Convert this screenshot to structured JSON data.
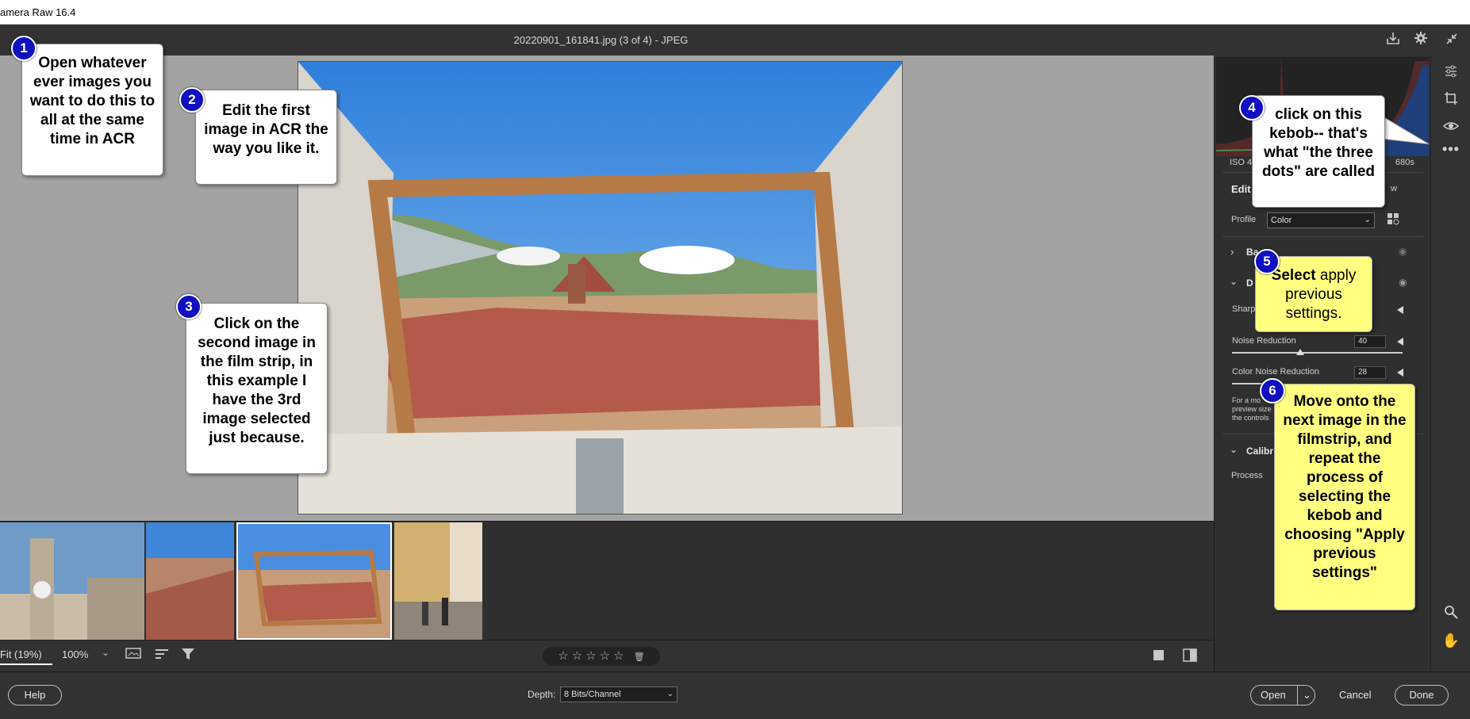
{
  "app": {
    "title": "amera Raw 16.4"
  },
  "header": {
    "filename": "20220901_161841.jpg (3 of 4)  -  JPEG"
  },
  "panel": {
    "histogram_left": "ISO 4",
    "histogram_right": "680s",
    "edit_label": "Edit",
    "edit_right": "w",
    "profile_label": "Profile",
    "profile_value": "Color",
    "basic_label": "Ba",
    "detail_label": "D",
    "sharpening_label": "Sharp",
    "noise_label": "Noise Reduction",
    "noise_value": "40",
    "noise_level": 0.4,
    "color_noise_label": "Color Noise Reduction",
    "color_noise_value": "28",
    "note_lines": [
      "For a mo",
      "preview size",
      "the controls"
    ],
    "calibration_label": "Calibr",
    "process_label": "Process"
  },
  "bottombar": {
    "zoom_fit": "Fit (19%)",
    "zoom_pct": "100%",
    "stars": "☆☆☆☆☆",
    "trash": "🗑"
  },
  "footer": {
    "help": "Help",
    "depth_label": "Depth:",
    "depth_value": "8 Bits/Channel",
    "open": "Open",
    "cancel": "Cancel",
    "done": "Done"
  },
  "callouts": [
    {
      "num": "1",
      "text": "Open whatever ever images you want to do this to all at the same time in ACR"
    },
    {
      "num": "2",
      "text": "Edit the first image in ACR the way you like it."
    },
    {
      "num": "3",
      "text": "Click on the second image in the film strip, in this example I have the 3rd image selected just because."
    },
    {
      "num": "4",
      "text": "click on this kebob-- that's what \"the three dots\" are called"
    },
    {
      "num": "5",
      "bold": "Select",
      "text": " apply previous settings."
    },
    {
      "num": "6",
      "text": "Move onto the next image in the filmstrip, and repeat the process of selecting the kebob and choosing \"Apply previous settings\""
    }
  ],
  "icons": {
    "header": [
      "save-icon",
      "gear-icon",
      "collapse-icon"
    ],
    "tools": [
      "edit-sliders-icon",
      "crop-icon",
      "redeye-icon",
      "more-kebab-icon",
      "zoom-icon",
      "hand-icon"
    ],
    "bottom": [
      "filmstrip-options-icon",
      "sort-icon",
      "filter-icon",
      "single-view-icon",
      "before-after-icon"
    ]
  },
  "colors": {
    "callout_yellow": "#ffff80",
    "badge_blue": "#1010c0",
    "canvas_gray": "#a3a3a3"
  }
}
